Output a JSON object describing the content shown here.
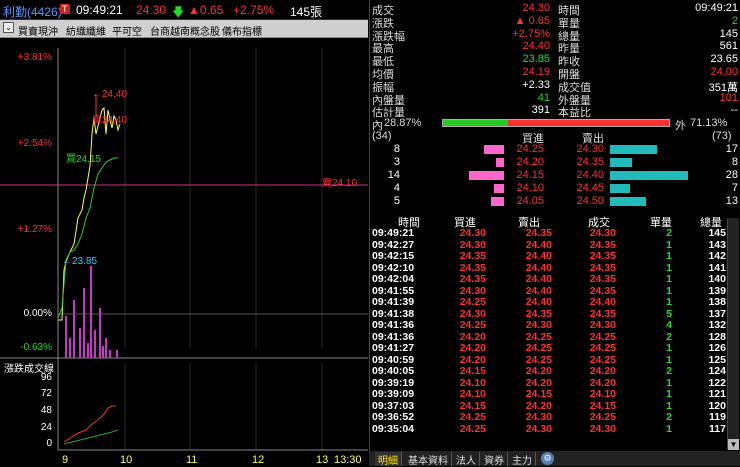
{
  "header": {
    "stock": "利勤(4426)",
    "badge": "T",
    "time": "09:49:21",
    "price": "24.30",
    "change_arrow": "▲",
    "change": "0.65",
    "change_pct": "+2.75%",
    "volume": "145張"
  },
  "toolbar": {
    "items": [
      "買賣現沖",
      "紡織纖維",
      "平可空",
      "台商越南概念股",
      "儀布指標"
    ]
  },
  "chart": {
    "y_labels": [
      "+3.81%",
      "+2.54%",
      "+1.27%",
      "0.00%",
      "-0.63%"
    ],
    "annotations": {
      "high": "24.40",
      "low": "23.85",
      "buy": "買24.15",
      "sell": "賣24.10",
      "bottom_label": "漲跌成交線",
      "mid_label1": "24.40",
      "mid_label2": "24.40"
    },
    "vol_y_labels": [
      "96",
      "72",
      "48",
      "24",
      "0"
    ],
    "x_labels": [
      "9",
      "10",
      "11",
      "12",
      "13",
      "13:30"
    ]
  },
  "quote": {
    "left": [
      {
        "label": "成交",
        "value": "24.30"
      },
      {
        "label": "漲跌",
        "value": "▲ 0.65"
      },
      {
        "label": "漲跌幅",
        "value": "+2.75%"
      },
      {
        "label": "最高",
        "value": "24.40"
      },
      {
        "label": "最低",
        "value": "23.85"
      },
      {
        "label": "均價",
        "value": "24.19"
      },
      {
        "label": "振幅",
        "value": "+2.33"
      },
      {
        "label": "內盤量",
        "value": "41"
      },
      {
        "label": "估計量",
        "value": "391"
      }
    ],
    "right": [
      {
        "label": "時間",
        "value": "09:49:21"
      },
      {
        "label": "單量",
        "value": "2"
      },
      {
        "label": "總量",
        "value": "145"
      },
      {
        "label": "昨量",
        "value": "561"
      },
      {
        "label": "昨收",
        "value": "23.65"
      },
      {
        "label": "開盤",
        "value": "24.00"
      },
      {
        "label": "成交值",
        "value": "351萬"
      },
      {
        "label": "外盤量",
        "value": "101"
      },
      {
        "label": "本益比",
        "value": "--"
      }
    ],
    "inner_label": "內",
    "inner_pct": "28.87%",
    "outer_label": "外",
    "outer_pct": "71.13%"
  },
  "book": {
    "bid_total": "(34)",
    "ask_total": "(73)",
    "bid_header": "買進",
    "ask_header": "賣出",
    "rows": [
      {
        "bid_qty": "8",
        "bid": "24.25",
        "ask": "24.30",
        "ask_qty": "17"
      },
      {
        "bid_qty": "3",
        "bid": "24.20",
        "ask": "24.35",
        "ask_qty": "8"
      },
      {
        "bid_qty": "14",
        "bid": "24.15",
        "ask": "24.40",
        "ask_qty": "28"
      },
      {
        "bid_qty": "4",
        "bid": "24.10",
        "ask": "24.45",
        "ask_qty": "7"
      },
      {
        "bid_qty": "5",
        "bid": "24.05",
        "ask": "24.50",
        "ask_qty": "13"
      }
    ]
  },
  "ticks": {
    "headers": [
      "時間",
      "買進",
      "賣出",
      "成交",
      "單量",
      "總量"
    ],
    "rows": [
      [
        "09:49:21",
        "24.30",
        "24.35",
        "24.30",
        "2",
        "145"
      ],
      [
        "09:42:27",
        "24.30",
        "24.40",
        "24.35",
        "1",
        "143"
      ],
      [
        "09:42:15",
        "24.35",
        "24.40",
        "24.35",
        "1",
        "142"
      ],
      [
        "09:42:10",
        "24.35",
        "24.40",
        "24.35",
        "1",
        "141"
      ],
      [
        "09:42:04",
        "24.35",
        "24.40",
        "24.35",
        "1",
        "140"
      ],
      [
        "09:41:55",
        "24.30",
        "24.40",
        "24.35",
        "1",
        "139"
      ],
      [
        "09:41:39",
        "24.25",
        "24.40",
        "24.40",
        "1",
        "138"
      ],
      [
        "09:41:38",
        "24.30",
        "24.35",
        "24.35",
        "5",
        "137"
      ],
      [
        "09:41:36",
        "24.25",
        "24.30",
        "24.30",
        "4",
        "132"
      ],
      [
        "09:41:36",
        "24.20",
        "24.25",
        "24.25",
        "2",
        "128"
      ],
      [
        "09:41:27",
        "24.20",
        "24.25",
        "24.25",
        "1",
        "126"
      ],
      [
        "09:40:59",
        "24.20",
        "24.25",
        "24.25",
        "1",
        "125"
      ],
      [
        "09:40:05",
        "24.15",
        "24.20",
        "24.20",
        "2",
        "124"
      ],
      [
        "09:39:19",
        "24.10",
        "24.20",
        "24.20",
        "1",
        "122"
      ],
      [
        "09:39:09",
        "24.10",
        "24.15",
        "24.10",
        "1",
        "121"
      ],
      [
        "09:37:03",
        "24.15",
        "24.20",
        "24.15",
        "1",
        "120"
      ],
      [
        "09:36:52",
        "24.25",
        "24.30",
        "24.25",
        "2",
        "119"
      ],
      [
        "09:35:04",
        "24.25",
        "24.30",
        "24.30",
        "1",
        "117"
      ]
    ]
  },
  "tabs": [
    "明細",
    "基本資料",
    "法人",
    "資券",
    "主力"
  ],
  "colors": {
    "up": "#ff3030",
    "down": "#22dd22",
    "bid_bar": "#ff66cc",
    "ask_bar": "#22bbbb"
  }
}
